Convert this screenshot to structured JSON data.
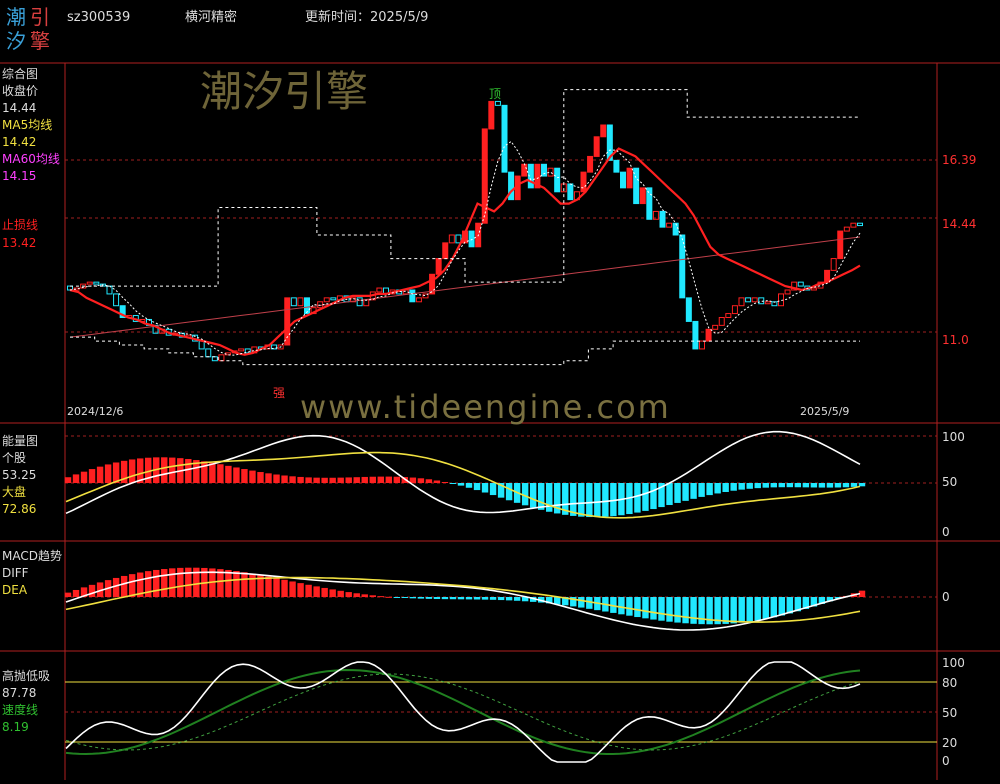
{
  "header": {
    "logo_chars": [
      "潮",
      "引",
      "汐",
      "擎"
    ],
    "code": "sz300539",
    "name": "横河精密",
    "update_label": "更新时间：2025/5/9"
  },
  "watermark": {
    "top": "潮汐引擎",
    "bottom": "www.tideengine.com"
  },
  "colors": {
    "up": "#ff2020",
    "down": "#20e8ff",
    "ma5": "#ffffff",
    "ma60": "#c0404a",
    "stop": "#ff2020",
    "yellow": "#f0e040",
    "green": "#208020",
    "grid": "#a02020",
    "magenta": "#ff40ff"
  },
  "main_panel": {
    "labels": {
      "title": "综合图",
      "close_label": "收盘价",
      "close_val": "14.44",
      "ma5_label": "MA5均线",
      "ma5_val": "14.42",
      "ma60_label": "MA60均线",
      "ma60_val": "14.15",
      "stop_label": "止损线",
      "stop_val": "13.42"
    },
    "right_ticks": [
      "16.39",
      "14.44",
      "11.0"
    ],
    "date_start": "2024/12/6",
    "date_end": "2025/5/9",
    "top_mark": "顶",
    "strong_mark": "强"
  },
  "energy_panel": {
    "labels": {
      "title": "能量图",
      "stock_label": "个股",
      "stock_val": "53.25",
      "market_label": "大盘",
      "market_val": "72.86"
    },
    "ticks": [
      "100",
      "50",
      "0"
    ]
  },
  "macd_panel": {
    "labels": {
      "title": "MACD趋势",
      "diff_label": "DIFF",
      "dea_label": "DEA"
    },
    "ticks": [
      "0"
    ]
  },
  "osc_panel": {
    "labels": {
      "title": "高抛低吸",
      "val": "87.78",
      "speed_label": "速度线",
      "speed_val": "8.19"
    },
    "ticks": [
      "100",
      "80",
      "50",
      "20",
      "0"
    ]
  },
  "chart_data": {
    "type": "candlestick",
    "title": "横河精密 sz300539",
    "x_range": [
      "2024/12/6",
      "2025/5/9"
    ],
    "candles": [
      {
        "o": 12.9,
        "c": 12.8
      },
      {
        "o": 12.8,
        "c": 12.85
      },
      {
        "o": 12.85,
        "c": 12.95
      },
      {
        "o": 12.95,
        "c": 13.0
      },
      {
        "o": 13.0,
        "c": 12.95
      },
      {
        "o": 12.95,
        "c": 12.9
      },
      {
        "o": 12.9,
        "c": 12.7
      },
      {
        "o": 12.7,
        "c": 12.4
      },
      {
        "o": 12.4,
        "c": 12.1
      },
      {
        "o": 12.1,
        "c": 12.15
      },
      {
        "o": 12.15,
        "c": 12.0
      },
      {
        "o": 12.0,
        "c": 12.05
      },
      {
        "o": 12.05,
        "c": 11.9
      },
      {
        "o": 11.9,
        "c": 11.7
      },
      {
        "o": 11.7,
        "c": 11.8
      },
      {
        "o": 11.8,
        "c": 11.65
      },
      {
        "o": 11.65,
        "c": 11.7
      },
      {
        "o": 11.7,
        "c": 11.6
      },
      {
        "o": 11.6,
        "c": 11.65
      },
      {
        "o": 11.65,
        "c": 11.5
      },
      {
        "o": 11.5,
        "c": 11.3
      },
      {
        "o": 11.3,
        "c": 11.1
      },
      {
        "o": 11.1,
        "c": 11.0
      },
      {
        "o": 11.0,
        "c": 11.15
      },
      {
        "o": 11.15,
        "c": 11.2
      },
      {
        "o": 11.2,
        "c": 11.25
      },
      {
        "o": 11.25,
        "c": 11.3
      },
      {
        "o": 11.3,
        "c": 11.2
      },
      {
        "o": 11.2,
        "c": 11.35
      },
      {
        "o": 11.35,
        "c": 11.3
      },
      {
        "o": 11.3,
        "c": 11.4
      },
      {
        "o": 11.4,
        "c": 11.3
      },
      {
        "o": 11.3,
        "c": 11.4
      },
      {
        "o": 11.4,
        "c": 12.6
      },
      {
        "o": 12.6,
        "c": 12.4
      },
      {
        "o": 12.4,
        "c": 12.6
      },
      {
        "o": 12.6,
        "c": 12.2
      },
      {
        "o": 12.2,
        "c": 12.35
      },
      {
        "o": 12.35,
        "c": 12.5
      },
      {
        "o": 12.5,
        "c": 12.6
      },
      {
        "o": 12.6,
        "c": 12.55
      },
      {
        "o": 12.55,
        "c": 12.65
      },
      {
        "o": 12.65,
        "c": 12.5
      },
      {
        "o": 12.5,
        "c": 12.6
      },
      {
        "o": 12.6,
        "c": 12.4
      },
      {
        "o": 12.4,
        "c": 12.55
      },
      {
        "o": 12.55,
        "c": 12.75
      },
      {
        "o": 12.75,
        "c": 12.85
      },
      {
        "o": 12.85,
        "c": 12.7
      },
      {
        "o": 12.7,
        "c": 12.8
      },
      {
        "o": 12.8,
        "c": 12.7
      },
      {
        "o": 12.7,
        "c": 12.8
      },
      {
        "o": 12.8,
        "c": 12.5
      },
      {
        "o": 12.5,
        "c": 12.6
      },
      {
        "o": 12.6,
        "c": 12.7
      },
      {
        "o": 12.7,
        "c": 13.2
      },
      {
        "o": 13.2,
        "c": 13.6
      },
      {
        "o": 13.6,
        "c": 14.0
      },
      {
        "o": 14.0,
        "c": 14.2
      },
      {
        "o": 14.2,
        "c": 14.0
      },
      {
        "o": 14.0,
        "c": 14.3
      },
      {
        "o": 14.3,
        "c": 13.9
      },
      {
        "o": 13.9,
        "c": 14.5
      },
      {
        "o": 14.5,
        "c": 16.9
      },
      {
        "o": 16.9,
        "c": 17.6
      },
      {
        "o": 17.6,
        "c": 17.5
      },
      {
        "o": 17.5,
        "c": 15.8
      },
      {
        "o": 15.8,
        "c": 15.1
      },
      {
        "o": 15.1,
        "c": 15.7
      },
      {
        "o": 15.7,
        "c": 16.0
      },
      {
        "o": 16.0,
        "c": 15.4
      },
      {
        "o": 15.4,
        "c": 16.0
      },
      {
        "o": 16.0,
        "c": 15.7
      },
      {
        "o": 15.7,
        "c": 15.9
      },
      {
        "o": 15.9,
        "c": 15.3
      },
      {
        "o": 15.3,
        "c": 15.5
      },
      {
        "o": 15.5,
        "c": 15.1
      },
      {
        "o": 15.1,
        "c": 15.3
      },
      {
        "o": 15.3,
        "c": 15.8
      },
      {
        "o": 15.8,
        "c": 16.2
      },
      {
        "o": 16.2,
        "c": 16.7
      },
      {
        "o": 16.7,
        "c": 17.0
      },
      {
        "o": 17.0,
        "c": 16.1
      },
      {
        "o": 16.1,
        "c": 15.8
      },
      {
        "o": 15.8,
        "c": 15.4
      },
      {
        "o": 15.4,
        "c": 15.9
      },
      {
        "o": 15.9,
        "c": 15.0
      },
      {
        "o": 15.0,
        "c": 15.4
      },
      {
        "o": 15.4,
        "c": 14.6
      },
      {
        "o": 14.6,
        "c": 14.8
      },
      {
        "o": 14.8,
        "c": 14.4
      },
      {
        "o": 14.4,
        "c": 14.5
      },
      {
        "o": 14.5,
        "c": 14.2
      },
      {
        "o": 14.2,
        "c": 12.6
      },
      {
        "o": 12.6,
        "c": 12.0
      },
      {
        "o": 12.0,
        "c": 11.3
      },
      {
        "o": 11.3,
        "c": 11.5
      },
      {
        "o": 11.5,
        "c": 11.8
      },
      {
        "o": 11.8,
        "c": 11.9
      },
      {
        "o": 11.9,
        "c": 12.1
      },
      {
        "o": 12.1,
        "c": 12.2
      },
      {
        "o": 12.2,
        "c": 12.4
      },
      {
        "o": 12.4,
        "c": 12.6
      },
      {
        "o": 12.6,
        "c": 12.5
      },
      {
        "o": 12.5,
        "c": 12.6
      },
      {
        "o": 12.6,
        "c": 12.45
      },
      {
        "o": 12.45,
        "c": 12.5
      },
      {
        "o": 12.5,
        "c": 12.4
      },
      {
        "o": 12.4,
        "c": 12.7
      },
      {
        "o": 12.7,
        "c": 12.8
      },
      {
        "o": 12.8,
        "c": 13.0
      },
      {
        "o": 13.0,
        "c": 12.9
      },
      {
        "o": 12.9,
        "c": 12.8
      },
      {
        "o": 12.8,
        "c": 12.85
      },
      {
        "o": 12.85,
        "c": 13.0
      },
      {
        "o": 13.0,
        "c": 13.3
      },
      {
        "o": 13.3,
        "c": 13.6
      },
      {
        "o": 13.6,
        "c": 14.3
      },
      {
        "o": 14.3,
        "c": 14.4
      },
      {
        "o": 14.4,
        "c": 14.5
      },
      {
        "o": 14.5,
        "c": 14.44
      }
    ],
    "stop_line": [
      12.8,
      12.75,
      12.6,
      12.5,
      12.4,
      12.3,
      12.2,
      12.1,
      12.05,
      11.95,
      11.9,
      11.8,
      11.7,
      11.65,
      11.6,
      11.55,
      11.5,
      11.45,
      11.4,
      11.3,
      11.2,
      11.15,
      11.2,
      11.3,
      11.4,
      11.6,
      11.8,
      12.0,
      12.1,
      12.2,
      12.3,
      12.4,
      12.5,
      12.6,
      12.65,
      12.65,
      12.65,
      12.7,
      12.7,
      12.75,
      12.8,
      12.85,
      12.9,
      13.0,
      13.1,
      13.3,
      13.6,
      14.0,
      14.5,
      15.0,
      14.9,
      14.8,
      15.0,
      15.3,
      15.5,
      15.6,
      15.5,
      15.4,
      15.2,
      15.0,
      15.0,
      15.1,
      15.3,
      15.6,
      15.9,
      16.2,
      16.4,
      16.3,
      16.2,
      16.0,
      15.8,
      15.6,
      15.4,
      15.2,
      15.0,
      14.7,
      14.3,
      13.9,
      13.7,
      13.6,
      13.5,
      13.4,
      13.3,
      13.2,
      13.1,
      13.0,
      12.9,
      12.85,
      12.8,
      12.85,
      12.95,
      13.0,
      13.1,
      13.2,
      13.3,
      13.42
    ],
    "ma60": [
      11.6,
      11.65,
      11.7,
      11.75,
      11.8,
      11.85,
      11.9,
      11.95,
      12.0,
      12.05,
      12.1,
      12.15,
      12.2,
      12.25,
      12.3,
      12.35,
      12.4,
      12.45,
      12.5,
      12.55,
      12.6,
      12.65,
      12.7,
      12.75,
      12.8,
      12.85,
      12.9,
      12.95,
      13.0,
      13.05,
      13.1,
      13.15,
      13.2,
      13.25,
      13.3,
      13.35,
      13.4,
      13.45,
      13.5,
      13.55,
      13.6,
      13.65,
      13.7,
      13.75,
      13.8,
      13.85,
      13.9,
      13.95,
      14.0,
      14.05,
      14.1,
      14.15
    ],
    "upper_band": [
      12.9,
      12.9,
      12.9,
      12.9,
      12.9,
      12.9,
      14.9,
      14.9,
      14.9,
      14.9,
      14.2,
      14.2,
      14.2,
      13.6,
      13.6,
      13.6,
      13.0,
      13.0,
      13.0,
      13.0,
      17.9,
      17.9,
      17.9,
      17.9,
      17.9,
      17.2,
      17.2,
      17.2,
      17.2,
      17.2,
      17.2,
      17.2
    ],
    "lower_band": [
      11.6,
      11.5,
      11.4,
      11.3,
      11.2,
      11.1,
      11.0,
      10.9,
      10.9,
      10.9,
      10.9,
      10.9,
      10.9,
      10.9,
      10.9,
      10.9,
      10.9,
      10.9,
      10.9,
      10.9,
      11.0,
      11.3,
      11.5,
      11.5,
      11.5,
      11.5,
      11.5,
      11.5,
      11.5,
      11.5,
      11.5,
      11.5
    ],
    "energy": {
      "stock_last": 53.25,
      "market_last": 72.86,
      "range": [
        0,
        100
      ]
    },
    "macd": {
      "range": [
        -1,
        1
      ]
    },
    "oscillator": {
      "last": 87.78,
      "speed_last": 8.19,
      "levels": [
        100,
        80,
        50,
        20,
        0
      ]
    }
  }
}
